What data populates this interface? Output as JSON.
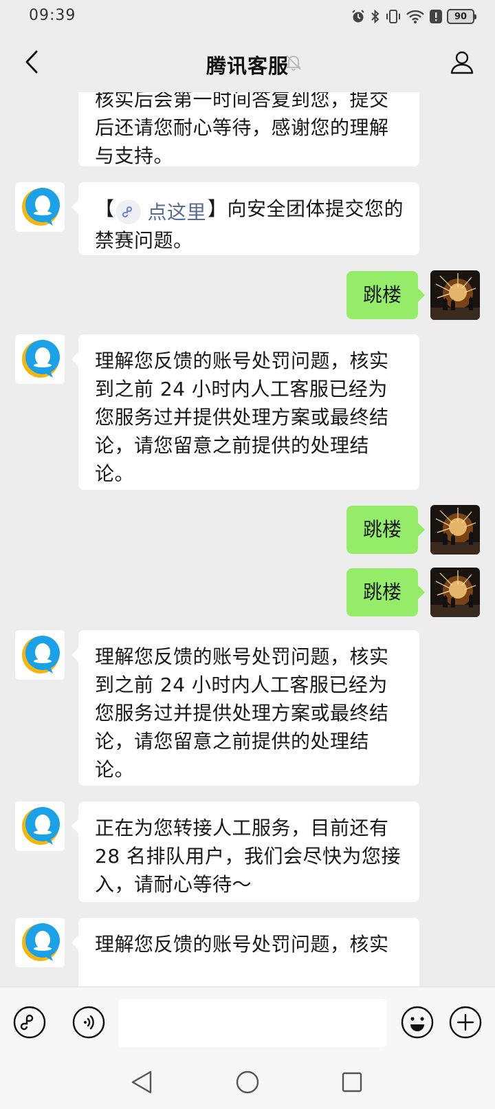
{
  "status_bar": {
    "time": "09:39",
    "battery_level": "90",
    "icons": [
      "alarm-icon",
      "bluetooth-icon",
      "vibrate-icon",
      "wifi-icon",
      "alert-icon",
      "battery-icon"
    ]
  },
  "nav": {
    "title": "腾讯客服",
    "icons": [
      "back-icon",
      "mute-bell-icon",
      "profile-icon"
    ]
  },
  "messages": [
    {
      "from": "agent",
      "text": "核实后会第一时间答复到您，提交后还请您耐心等待，感谢您的理解与支持。"
    },
    {
      "from": "agent",
      "prefix": "【",
      "link_label": "点这里",
      "suffix": "】向安全团体提交您的禁赛问题。"
    },
    {
      "from": "user",
      "text": "跳楼"
    },
    {
      "from": "agent",
      "text": "理解您反馈的账号处罚问题，核实到之前 24 小时内人工客服已经为您服务过并提供处理方案或最终结论，请您留意之前提供的处理结论。"
    },
    {
      "from": "user",
      "text": "跳楼"
    },
    {
      "from": "user",
      "text": "跳楼"
    },
    {
      "from": "agent",
      "text": "理解您反馈的账号处罚问题，核实到之前 24 小时内人工客服已经为您服务过并提供处理方案或最终结论，请您留意之前提供的处理结论。"
    },
    {
      "from": "agent",
      "text": "正在为您转接人工服务，目前还有 28 名排队用户，我们会尽快为您接入，请耐心等待～"
    },
    {
      "from": "agent",
      "text": "理解您反馈的账号处罚问题，核实"
    }
  ],
  "input_bar": {
    "value": "",
    "placeholder": "",
    "icons": [
      "mini-program-icon",
      "voice-icon",
      "emoji-icon",
      "plus-icon"
    ]
  },
  "system_nav": {
    "icons": [
      "nav-back-icon",
      "nav-home-icon",
      "nav-recents-icon"
    ]
  },
  "colors": {
    "background": "#ededed",
    "bubble_in": "#ffffff",
    "bubble_out": "#95ec69",
    "link": "#576b95",
    "qq_blue": "#1aa1e8",
    "qq_yellow": "#f5b70f"
  }
}
